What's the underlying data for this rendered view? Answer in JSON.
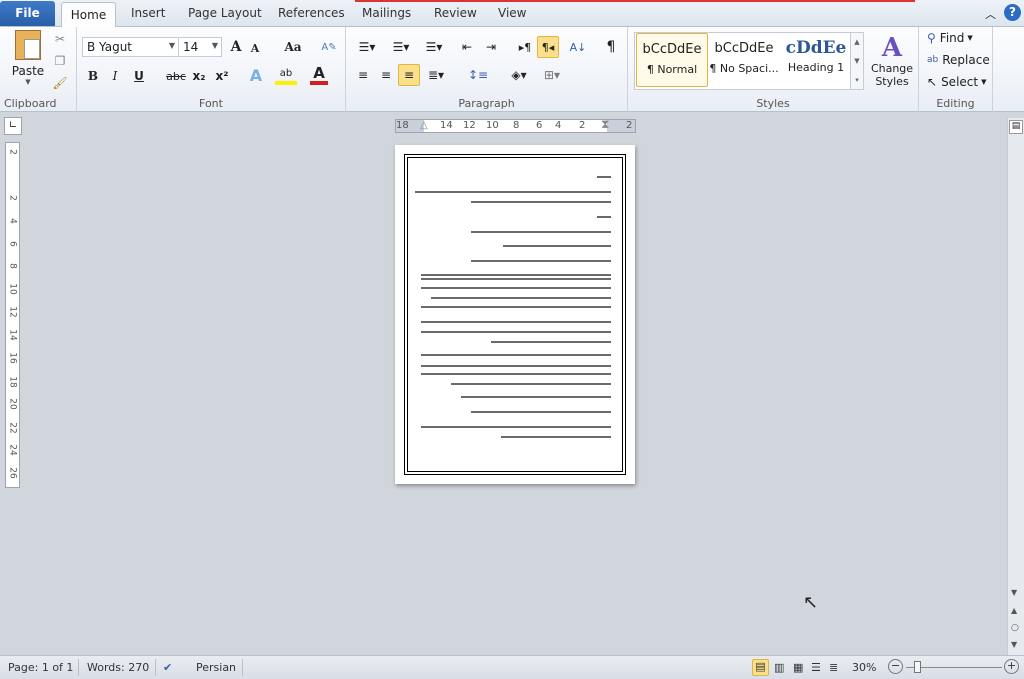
{
  "tabs": {
    "file": "File",
    "items": [
      "Home",
      "Insert",
      "Page Layout",
      "References",
      "Mailings",
      "Review",
      "View"
    ],
    "active": "Home"
  },
  "clipboard": {
    "paste": "Paste",
    "label": "Clipboard"
  },
  "font": {
    "name": "B Yagut",
    "size": "14",
    "label": "Font",
    "bold": "B",
    "italic": "I",
    "underline": "U",
    "strike": "abc",
    "sub": "x₂",
    "sup": "x²",
    "grow": "A",
    "shrink": "A",
    "case": "Aa",
    "color_font": "#d22020",
    "color_highlight": "#ffef00"
  },
  "paragraph": {
    "label": "Paragraph",
    "active_align": "right",
    "rtl_active": true
  },
  "styles": {
    "label": "Styles",
    "items": [
      {
        "preview": "bCcDdEe",
        "name": "¶ Normal"
      },
      {
        "preview": "bCcDdEe",
        "name": "¶ No Spaci..."
      },
      {
        "preview": "cDdEe",
        "name": "Heading 1"
      }
    ],
    "change": "Change Styles"
  },
  "editing": {
    "label": "Editing",
    "find": "Find",
    "replace": "Replace",
    "select": "Select"
  },
  "ruler": {
    "h_ticks": [
      "18",
      "14",
      "12",
      "10",
      "8",
      "6",
      "4",
      "2",
      "2"
    ],
    "v_ticks": [
      "2",
      "2",
      "4",
      "6",
      "8",
      "10",
      "12",
      "14",
      "16",
      "18",
      "20",
      "22",
      "24",
      "26"
    ]
  },
  "status": {
    "page": "Page: 1 of 1",
    "words": "Words: 270",
    "language": "Persian",
    "zoom": "30%",
    "zoom_level": 30
  },
  "colors": {
    "accent": "#2a5ea8",
    "highlight": "#fbe08c"
  }
}
